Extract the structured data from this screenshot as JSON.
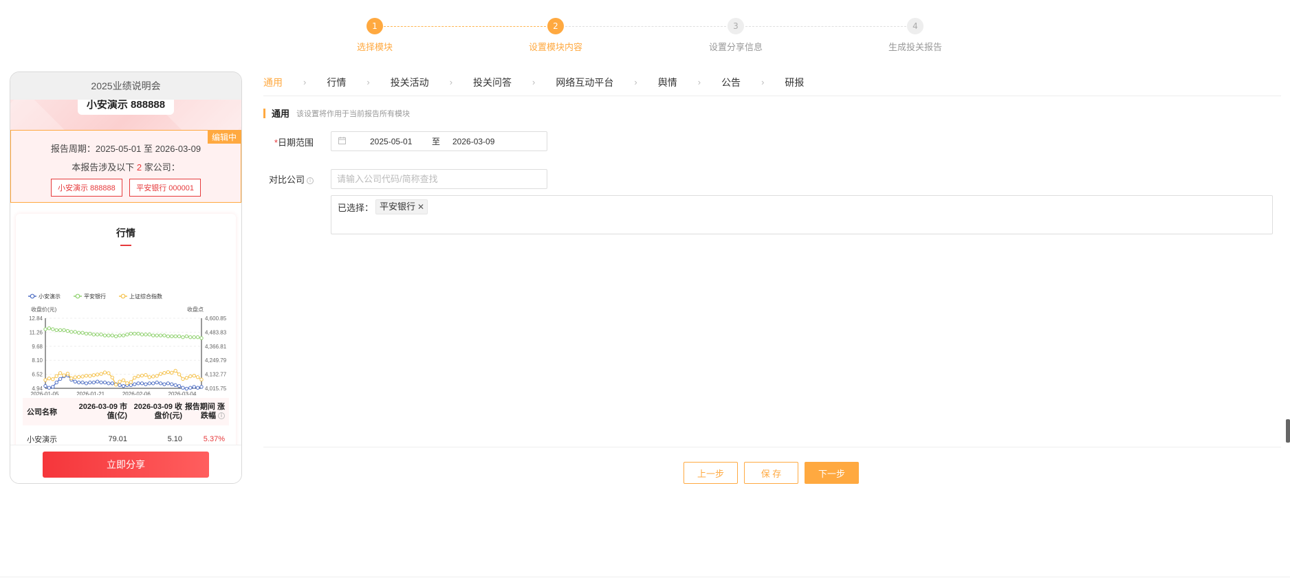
{
  "steps": [
    {
      "num": "1",
      "label": "选择模块",
      "state": "active"
    },
    {
      "num": "2",
      "label": "设置模块内容",
      "state": "active"
    },
    {
      "num": "3",
      "label": "设置分享信息",
      "state": "todo"
    },
    {
      "num": "4",
      "label": "生成投关报告",
      "state": "todo"
    }
  ],
  "preview": {
    "title": "2025业绩说明会",
    "company_banner": "小安演示 888888",
    "editing_tag": "编辑中",
    "period": "报告周期：2025-05-01 至 2026-03-09",
    "involve_prefix": "本报告涉及以下 ",
    "involve_count": "2",
    "involve_suffix": " 家公司：",
    "company_tags": [
      "小安演示 888888",
      "平安银行 000001"
    ],
    "card_title": "行情",
    "table": {
      "headers": [
        "公司名称",
        "2026-03-09 市值(亿)",
        "2026-03-09 收盘价(元)",
        "报告期间 涨跌幅"
      ],
      "rows": [
        {
          "name": "小安演示",
          "mv": "79.01",
          "close": "5.10",
          "chg": "5.37%"
        }
      ]
    },
    "share_button": "立即分享"
  },
  "chart_data": {
    "type": "line",
    "legend": [
      "小安演示",
      "平安银行",
      "上证综合指数"
    ],
    "legend_placement": "top-left",
    "ylabel_left": "收盘价(元)",
    "ylabel_right": "收盘点",
    "y_left_ticks": [
      "12.84",
      "11.26",
      "9.68",
      "8.10",
      "6.52",
      "4.94"
    ],
    "y_right_ticks": [
      "4,600.85",
      "4,483.83",
      "4,366.81",
      "4,249.79",
      "4,132.77",
      "4,015.75"
    ],
    "ylim_left": [
      4.94,
      12.84
    ],
    "ylim_right": [
      4015.75,
      4600.85
    ],
    "x_ticks": [
      "2026-01-05",
      "2026-01-21",
      "2026-02-06",
      "2026-03-04"
    ],
    "series": [
      {
        "name": "小安演示",
        "axis": "left",
        "color": "#4f6fc4",
        "values": [
          5.2,
          5.0,
          5.1,
          5.6,
          6.0,
          6.3,
          6.4,
          5.9,
          5.7,
          5.6,
          5.6,
          5.5,
          5.6,
          5.6,
          5.7,
          5.6,
          5.6,
          5.5,
          5.5,
          5.4,
          5.3,
          5.2,
          5.3,
          5.3,
          5.4,
          5.5,
          5.5,
          5.4,
          5.5,
          5.5,
          5.6,
          5.5,
          5.4,
          5.5,
          5.4,
          5.3,
          5.2,
          5.0,
          4.9,
          5.0,
          5.1,
          5.0,
          5.1
        ]
      },
      {
        "name": "平安银行",
        "axis": "left",
        "color": "#8fd16e",
        "values": [
          11.6,
          11.7,
          11.6,
          11.5,
          11.5,
          11.5,
          11.4,
          11.3,
          11.3,
          11.2,
          11.2,
          11.1,
          11.1,
          11.0,
          11.0,
          11.0,
          10.9,
          10.9,
          10.9,
          10.8,
          10.9,
          10.9,
          11.0,
          11.1,
          11.1,
          11.1,
          11.0,
          11.0,
          11.0,
          10.9,
          10.9,
          10.9,
          10.9,
          10.8,
          10.8,
          10.8,
          10.8,
          10.7,
          10.8,
          10.7,
          10.7,
          10.7,
          10.6
        ]
      },
      {
        "name": "上证综合指数",
        "axis": "right",
        "color": "#f5c24c",
        "values": [
          4085,
          4098,
          4092,
          4118,
          4143,
          4124,
          4138,
          4099,
          4108,
          4110,
          4114,
          4121,
          4119,
          4126,
          4131,
          4136,
          4148,
          4142,
          4106,
          4046,
          4072,
          4083,
          4058,
          4068,
          4104,
          4116,
          4122,
          4127,
          4109,
          4114,
          4119,
          4136,
          4144,
          4151,
          4146,
          4162,
          4132,
          4094,
          4103,
          4116,
          4121,
          4109,
          4089
        ]
      }
    ]
  },
  "config": {
    "tabs": [
      "通用",
      "行情",
      "投关活动",
      "投关问答",
      "网络互动平台",
      "舆情",
      "公告",
      "研报"
    ],
    "active_tab": 0,
    "tab_separator": "›",
    "section_title": "通用",
    "section_desc": "该设置将作用于当前报告所有模块",
    "date_label": "日期范围",
    "date_required": "*",
    "date_start": "2025-05-01",
    "date_to": "至",
    "date_end": "2026-03-09",
    "compare_label": "对比公司",
    "compare_placeholder": "请输入公司代码/简称查找",
    "selected_label": "已选择：",
    "selected_chip": "平安银行"
  },
  "actions": {
    "prev": "上一步",
    "save": "保 存",
    "next": "下一步"
  },
  "colors": {
    "accent": "#ffa940",
    "red": "#e6393b"
  }
}
